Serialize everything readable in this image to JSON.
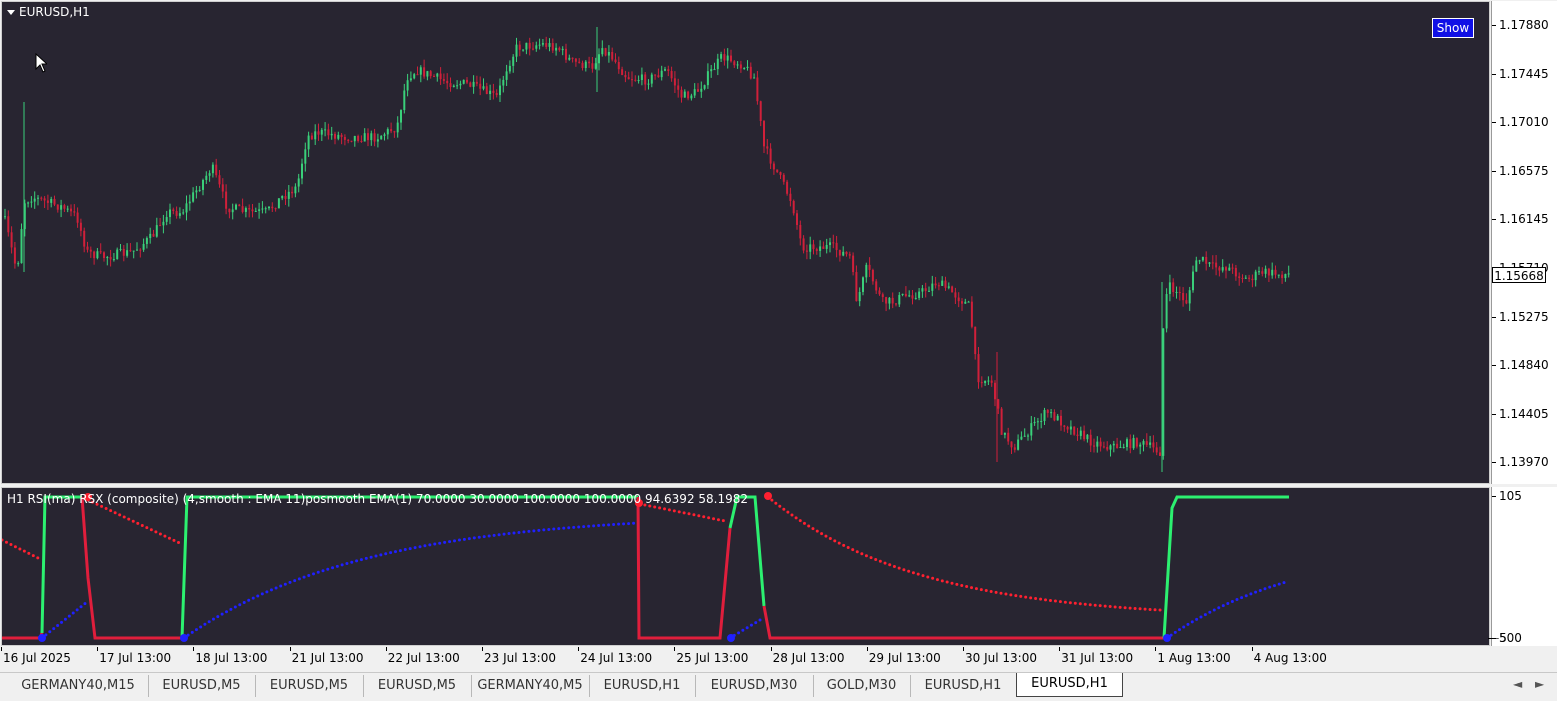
{
  "chart": {
    "title": "EURUSD,H1",
    "show_button": "Show",
    "current_price": "1.15668",
    "price_levels": [
      "1.17880",
      "1.17445",
      "1.17010",
      "1.16575",
      "1.16145",
      "1.15710",
      "1.15275",
      "1.14840",
      "1.14405",
      "1.13970"
    ],
    "colors": {
      "background": "#282531",
      "bull": "#3ad07a",
      "bear": "#d0203a"
    }
  },
  "indicator": {
    "title": "H1 RSI(ma) RSX (composite) (4,smooth : EMA  11)posmooth EMA(1) 70.0000 30.0000 100.0000 100.0000 94.6392 58.1982",
    "levels": [
      "105",
      "-5",
      "500"
    ],
    "colors": {
      "up": "#2cf070",
      "down": "#e01e3c",
      "dot_red": "#ff2030",
      "dot_blue": "#2020ff"
    }
  },
  "time_axis": [
    "16 Jul 2025",
    "17 Jul 13:00",
    "18 Jul 13:00",
    "21 Jul 13:00",
    "22 Jul 13:00",
    "23 Jul 13:00",
    "24 Jul 13:00",
    "25 Jul 13:00",
    "28 Jul 13:00",
    "29 Jul 13:00",
    "30 Jul 13:00",
    "31 Jul 13:00",
    "1 Aug 13:00",
    "4 Aug 13:00"
  ],
  "tabs": [
    "GERMANY40,M15",
    "EURUSD,M5",
    "EURUSD,M5",
    "EURUSD,M5",
    "GERMANY40,M5",
    "EURUSD,H1",
    "EURUSD,M30",
    "GOLD,M30",
    "EURUSD,H1",
    "EURUSD,H1"
  ],
  "active_tab_index": 9,
  "scroll": {
    "left": "◄",
    "right": "►"
  }
}
